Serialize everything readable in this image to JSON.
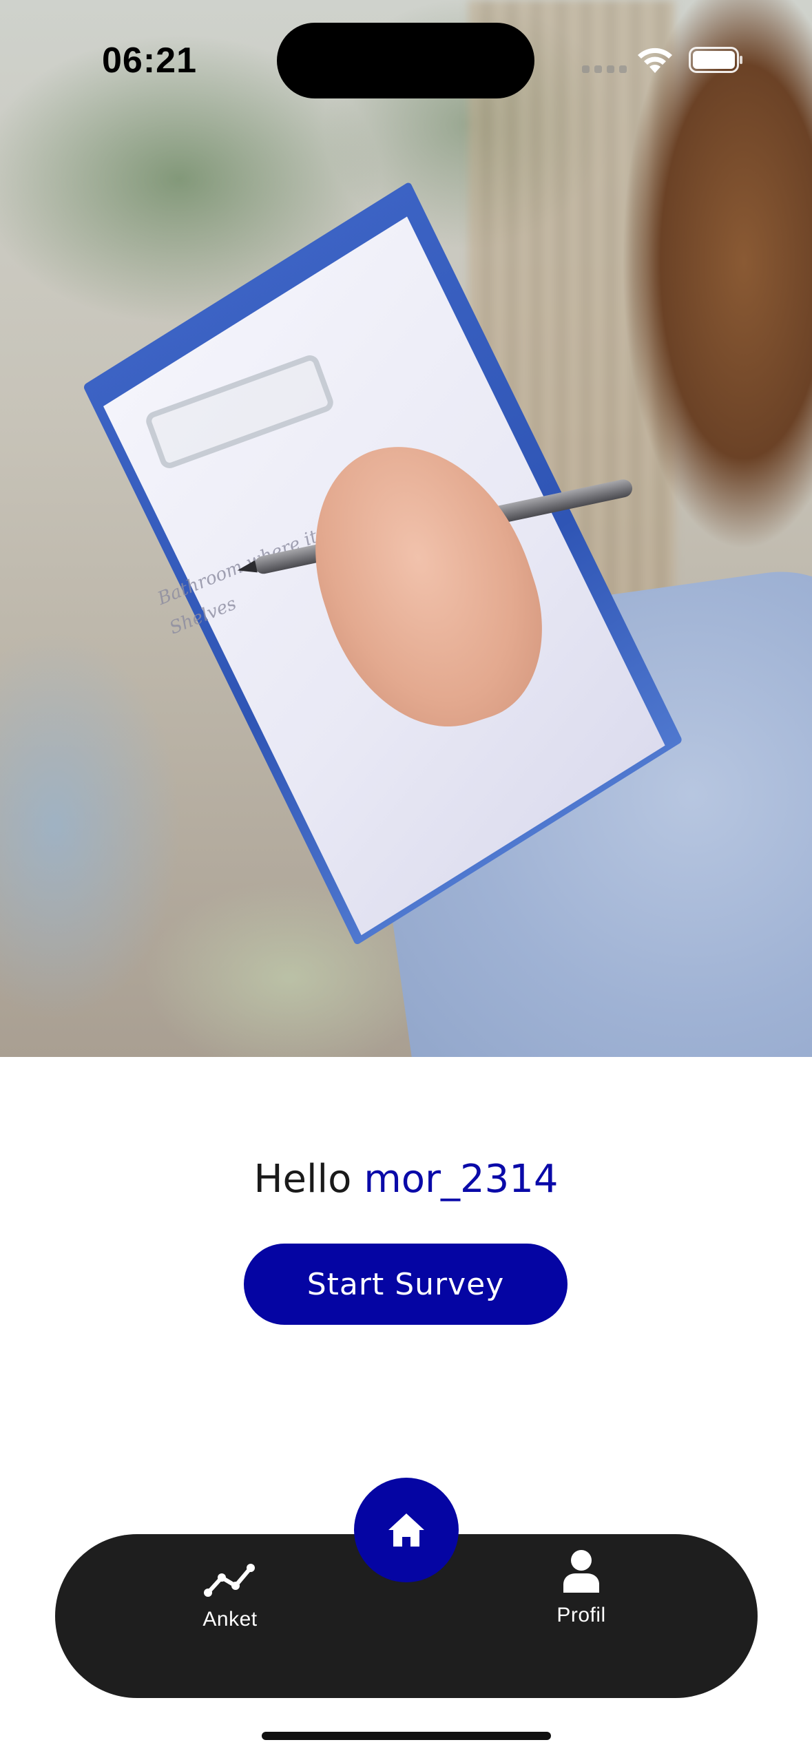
{
  "status_bar": {
    "time": "06:21"
  },
  "hero": {
    "image": "person-writing-on-clipboard-photo",
    "scribble_lines": [
      "Bathroom where it",
      "Shelves"
    ]
  },
  "greeting": {
    "prefix": "Hello",
    "username": "mor_2314"
  },
  "start_survey": {
    "label": "Start Survey"
  },
  "tab_bar": {
    "items": [
      {
        "label": "Anket",
        "icon": "line-chart-icon"
      },
      {
        "label": "Profil",
        "icon": "person-icon"
      }
    ],
    "center": {
      "icon": "home-icon"
    }
  },
  "colors": {
    "accent": "#0505a3",
    "username": "#0a0aa8",
    "tab_bar_bg": "#1e1e1e"
  }
}
